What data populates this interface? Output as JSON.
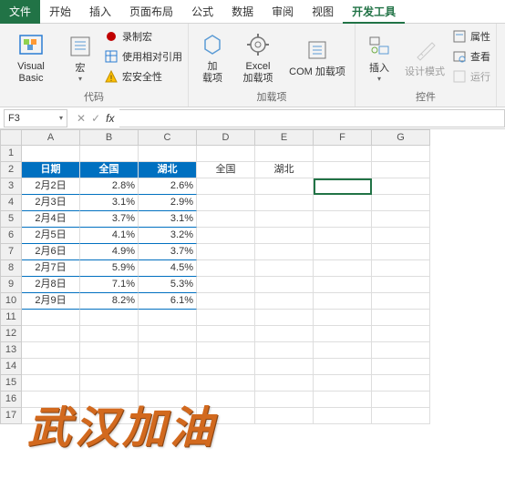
{
  "tabs": {
    "file": "文件",
    "home": "开始",
    "insert": "插入",
    "layout": "页面布局",
    "formula": "公式",
    "data": "数据",
    "review": "审阅",
    "view": "视图",
    "dev": "开发工具"
  },
  "ribbon": {
    "vb": "Visual Basic",
    "macro": "宏",
    "record": "录制宏",
    "relref": "使用相对引用",
    "security": "宏安全性",
    "code_group": "代码",
    "addins": "加\n载项",
    "excel_addins": "Excel\n加载项",
    "com_addins": "COM 加载项",
    "addins_group": "加载项",
    "insert": "插入",
    "design": "设计模式",
    "props": "属性",
    "view_code": "查看",
    "run": "运行",
    "controls_group": "控件"
  },
  "namebox": "F3",
  "cols": [
    "A",
    "B",
    "C",
    "D",
    "E",
    "F",
    "G"
  ],
  "header": {
    "a": "日期",
    "b": "全国",
    "c": "湖北"
  },
  "extra": {
    "d": "全国",
    "e": "湖北"
  },
  "data": [
    {
      "d": "2月2日",
      "n": "2.8%",
      "h": "2.6%"
    },
    {
      "d": "2月3日",
      "n": "3.1%",
      "h": "2.9%"
    },
    {
      "d": "2月4日",
      "n": "3.7%",
      "h": "3.1%"
    },
    {
      "d": "2月5日",
      "n": "4.1%",
      "h": "3.2%"
    },
    {
      "d": "2月6日",
      "n": "4.9%",
      "h": "3.7%"
    },
    {
      "d": "2月7日",
      "n": "5.9%",
      "h": "4.5%"
    },
    {
      "d": "2月8日",
      "n": "7.1%",
      "h": "5.3%"
    },
    {
      "d": "2月9日",
      "n": "8.2%",
      "h": "6.1%"
    }
  ],
  "art": "武汉加油",
  "chart_data": {
    "type": "table",
    "title": "",
    "categories": [
      "2月2日",
      "2月3日",
      "2月4日",
      "2月5日",
      "2月6日",
      "2月7日",
      "2月8日",
      "2月9日"
    ],
    "series": [
      {
        "name": "全国",
        "values": [
          2.8,
          3.1,
          3.7,
          4.1,
          4.9,
          5.9,
          7.1,
          8.2
        ]
      },
      {
        "name": "湖北",
        "values": [
          2.6,
          2.9,
          3.1,
          3.2,
          3.7,
          4.5,
          5.3,
          6.1
        ]
      }
    ],
    "xlabel": "日期",
    "ylabel": "%",
    "ylim": [
      0,
      10
    ]
  }
}
